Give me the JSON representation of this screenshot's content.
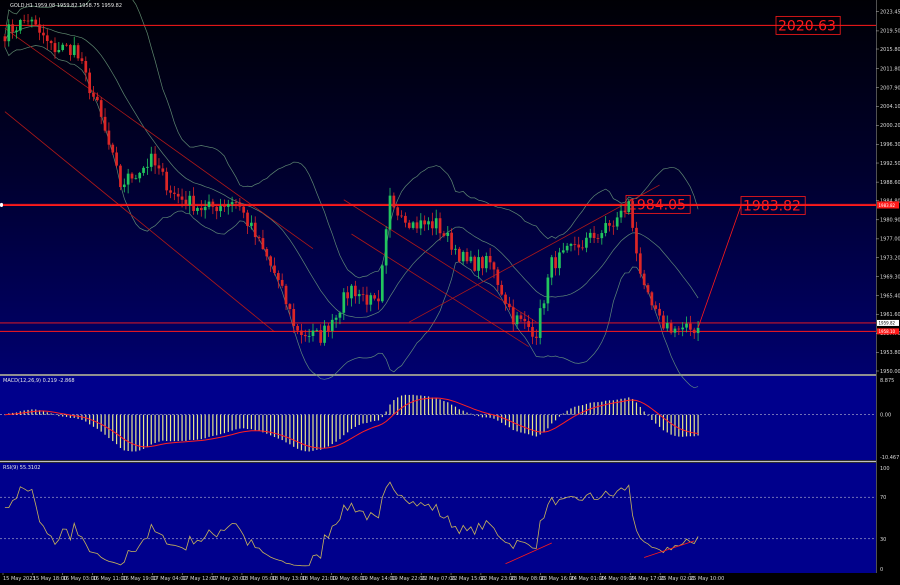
{
  "chart_data": {
    "type": "candlestick",
    "symbol_title": "GOLD,H1  1959.08 1959.82 1958.75 1959.82",
    "price_axis": {
      "ylim": [
        1950.0,
        2025.0
      ],
      "ticks": [
        "2023.45",
        "2019.50",
        "2015.80",
        "2011.80",
        "2007.90",
        "2004.10",
        "2000.20",
        "1996.30",
        "1992.50",
        "1988.60",
        "1984.80",
        "1980.90",
        "1977.00",
        "1973.20",
        "1969.30",
        "1965.40",
        "1961.60",
        "1957.70",
        "1953.80",
        "1950.00"
      ],
      "current_price_label": "1959.82",
      "level_price_labels": [
        "1984.05",
        "1983.82",
        "1958.10"
      ]
    },
    "levels": [
      {
        "name": "top-level",
        "price": 2020.63,
        "label": "2020.63"
      },
      {
        "name": "left-peak-level",
        "price": 1984.05,
        "label": "1984.05"
      },
      {
        "name": "target-level",
        "price": 1983.82,
        "label": "1983.82"
      },
      {
        "name": "support-upper",
        "price": 1959.82
      },
      {
        "name": "support-lower",
        "price": 1958.1
      }
    ],
    "x_labels": [
      "15 May 2023",
      "15 May 18:00",
      "16 May 03:00",
      "16 May 11:00",
      "16 May 19:00",
      "17 May 04:00",
      "17 May 12:00",
      "17 May 20:00",
      "18 May 05:00",
      "18 May 13:00",
      "18 May 21:00",
      "19 May 06:00",
      "19 May 14:00",
      "19 May 22:00",
      "22 May 07:00",
      "22 May 15:00",
      "22 May 23:00",
      "23 May 08:00",
      "23 May 16:00",
      "24 May 01:00",
      "24 May 09:00",
      "24 May 17:00",
      "25 May 02:00",
      "25 May 10:00"
    ],
    "keypoints": [
      [
        0,
        2019
      ],
      [
        6,
        2022
      ],
      [
        12,
        2016
      ],
      [
        18,
        2016
      ],
      [
        24,
        2004
      ],
      [
        30,
        1988
      ],
      [
        38,
        1993
      ],
      [
        44,
        1986
      ],
      [
        52,
        1983
      ],
      [
        60,
        1985
      ],
      [
        70,
        1970
      ],
      [
        76,
        1958
      ],
      [
        82,
        1957
      ],
      [
        90,
        1967
      ],
      [
        97,
        1963
      ],
      [
        100,
        1985
      ],
      [
        106,
        1980
      ],
      [
        112,
        1980
      ],
      [
        120,
        1972
      ],
      [
        126,
        1972
      ],
      [
        132,
        1961
      ],
      [
        138,
        1958
      ],
      [
        142,
        1972
      ],
      [
        150,
        1976
      ],
      [
        158,
        1980
      ],
      [
        162,
        1984
      ],
      [
        166,
        1966
      ],
      [
        170,
        1960
      ],
      [
        176,
        1958
      ],
      [
        180,
        1959
      ]
    ],
    "bollinger": {
      "period": 20
    },
    "macd": {
      "title": "MACD(12,26,9) 0.219 -2.868",
      "ticks": [
        "8.875",
        "0.00",
        "-10.467"
      ],
      "ylim": [
        -10.467,
        8.875
      ]
    },
    "rsi": {
      "title": "RSI(9) 55.3102",
      "ticks": [
        "100",
        "70",
        "30",
        "0"
      ],
      "ylim": [
        0,
        100
      ],
      "levels": [
        70,
        30
      ]
    },
    "colors": {
      "bull": "#22c55e",
      "bear": "#dc2626",
      "level": "#ff1a1a",
      "band": "#6f9f7f",
      "macd_hist": "#e6e68c",
      "macd_signal": "#ff2020",
      "rsi_line": "#c8b45a",
      "panel_bg": "#00008c"
    }
  }
}
